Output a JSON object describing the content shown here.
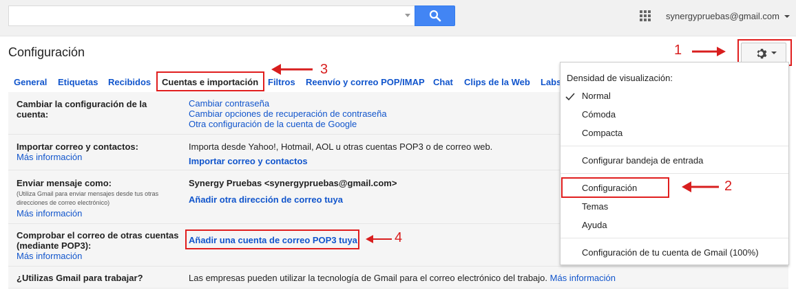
{
  "topbar": {
    "search_value": "",
    "account_email": "synergypruebas@gmail.com"
  },
  "page": {
    "title": "Configuración"
  },
  "tabs": [
    {
      "label": "General",
      "active": false
    },
    {
      "label": "Etiquetas",
      "active": false
    },
    {
      "label": "Recibidos",
      "active": false
    },
    {
      "label": "Cuentas e importación",
      "active": true
    },
    {
      "label": "Filtros",
      "active": false
    },
    {
      "label": "Reenvío y correo POP/IMAP",
      "active": false
    },
    {
      "label": "Chat",
      "active": false
    },
    {
      "label": "Clips de la Web",
      "active": false
    },
    {
      "label": "Labs",
      "active": false
    }
  ],
  "rows": {
    "account": {
      "label_line1": "Cambiar la configuración de la",
      "label_line2": "cuenta:",
      "links": [
        "Cambiar contraseña",
        "Cambiar opciones de recuperación de contraseña",
        "Otra configuración de la cuenta de Google"
      ]
    },
    "import": {
      "label": "Importar correo y contactos:",
      "more": "Más información",
      "text": "Importa desde Yahoo!, Hotmail, AOL u otras cuentas POP3 o de correo web.",
      "action": "Importar correo y contactos"
    },
    "send_as": {
      "label": "Enviar mensaje como:",
      "sub": "(Utiliza Gmail para enviar mensajes desde tus otras direcciones de correo electrónico)",
      "more": "Más información",
      "address": "Synergy Pruebas <synergypruebas@gmail.com>",
      "action": "Añadir otra dirección de correo tuya"
    },
    "pop3": {
      "label_line1": "Comprobar el correo de otras cuentas",
      "label_line2": "(mediante POP3):",
      "more": "Más información",
      "action": "Añadir una cuenta de correo POP3 tuya"
    },
    "work": {
      "label": "¿Utilizas Gmail para trabajar?",
      "text": "Las empresas pueden utilizar la tecnología de Gmail para el correo electrónico del trabajo.",
      "more": "Más información"
    }
  },
  "menu": {
    "heading": "Densidad de visualización:",
    "density": [
      "Normal",
      "Cómoda",
      "Compacta"
    ],
    "selected_density": "Normal",
    "inbox": "Configurar bandeja de entrada",
    "settings": "Configuración",
    "themes": "Temas",
    "help": "Ayuda",
    "account_settings": "Configuración de tu cuenta de Gmail (100%)"
  },
  "annotations": {
    "n1": "1",
    "n2": "2",
    "n3": "3",
    "n4": "4",
    "color": "#d81e1e"
  },
  "colors": {
    "link": "#1155cc",
    "search_button": "#4285f4",
    "highlight": "#e01d1d"
  }
}
